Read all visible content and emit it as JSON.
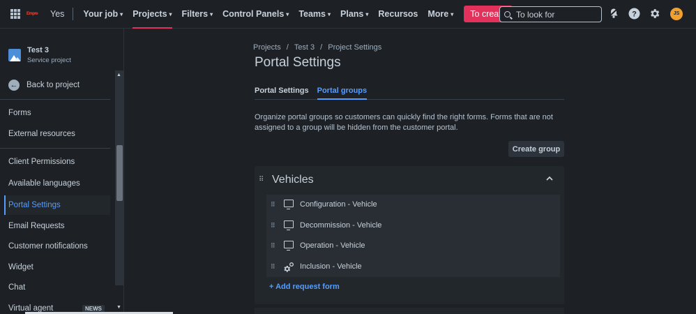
{
  "topnav": {
    "logo_text": "Empre",
    "items": [
      {
        "label": "Yes",
        "chevron": false
      },
      {
        "label": "Your job",
        "chevron": true
      },
      {
        "label": "Projects",
        "chevron": true
      },
      {
        "label": "Filters",
        "chevron": true
      },
      {
        "label": "Control Panels",
        "chevron": true
      },
      {
        "label": "Teams",
        "chevron": true
      },
      {
        "label": "Plans",
        "chevron": true
      },
      {
        "label": "Recursos",
        "chevron": false
      },
      {
        "label": "More",
        "chevron": true
      }
    ],
    "create_label": "To create",
    "search_placeholder": "To look for",
    "avatar_initials": "JS",
    "accent": "#e2315a"
  },
  "sidebar": {
    "project_name": "Test 3",
    "project_type": "Service project",
    "back_label": "Back to project",
    "items": [
      {
        "label": "Forms"
      },
      {
        "label": "External resources"
      },
      {
        "label": "Client Permissions"
      },
      {
        "label": "Available languages"
      },
      {
        "label": "Portal Settings"
      },
      {
        "label": "Email Requests"
      },
      {
        "label": "Customer notifications"
      },
      {
        "label": "Widget"
      },
      {
        "label": "Chat"
      },
      {
        "label": "Virtual agent",
        "badge": "NEWS"
      }
    ]
  },
  "main": {
    "breadcrumb": [
      "Projects",
      "Test 3",
      "Project Settings"
    ],
    "title": "Portal Settings",
    "tabs": [
      {
        "label": "Portal Settings"
      },
      {
        "label": "Portal groups"
      }
    ],
    "description": "Organize portal groups so customers can quickly find the right forms. Forms that are not assigned to a group will be hidden from the customer portal.",
    "create_group_label": "Create group",
    "group": {
      "title": "Vehicles",
      "forms": [
        {
          "label": "Configuration - Vehicle",
          "icon": "monitor-icon"
        },
        {
          "label": "Decommission - Vehicle",
          "icon": "monitor-icon"
        },
        {
          "label": "Operation - Vehicle",
          "icon": "monitor-icon"
        },
        {
          "label": "Inclusion - Vehicle",
          "icon": "gears-icon"
        }
      ],
      "add_form_label": "+ Add request form"
    }
  }
}
